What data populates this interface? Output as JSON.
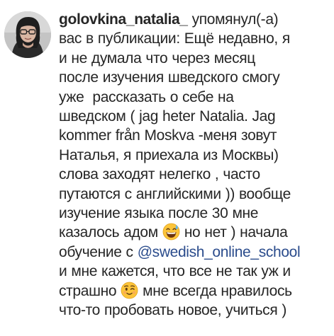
{
  "notification": {
    "username": "golovkina_natalia_",
    "action": " упомянул(-а)",
    "lines": [
      "вас в публикации: Ещё недавно, я",
      "и не думала что через месяц",
      "после изучения шведского смогу",
      "уже  рассказать о себе на",
      "шведском ( jag heter Natalia. Jag",
      "kommer från Moskva -меня зовут",
      "Наталья, я приехала из Москвы)",
      "слова заходят нелегко , часто",
      "путаются с английскими )) вообще",
      "изучение языка после 30 мне"
    ],
    "line11_before": "казалось адом ",
    "emoji1": "sweat-smile-emoji",
    "line11_after": " но нет ) начала",
    "line12_before": "обучение с ",
    "mention": "@swedish_online_school",
    "line13": "и мне кажется, что все не так уж и",
    "line14_before": "страшно ",
    "emoji2": "winking-face-emoji",
    "line14_after": " мне всегда нравилось",
    "line15": "что-то пробовать новое, учиться )"
  },
  "icons": {
    "avatar": "profile-photo-avatar"
  },
  "colors": {
    "text": "#262626",
    "mention": "#2b4c8c",
    "background": "#ffffff"
  }
}
